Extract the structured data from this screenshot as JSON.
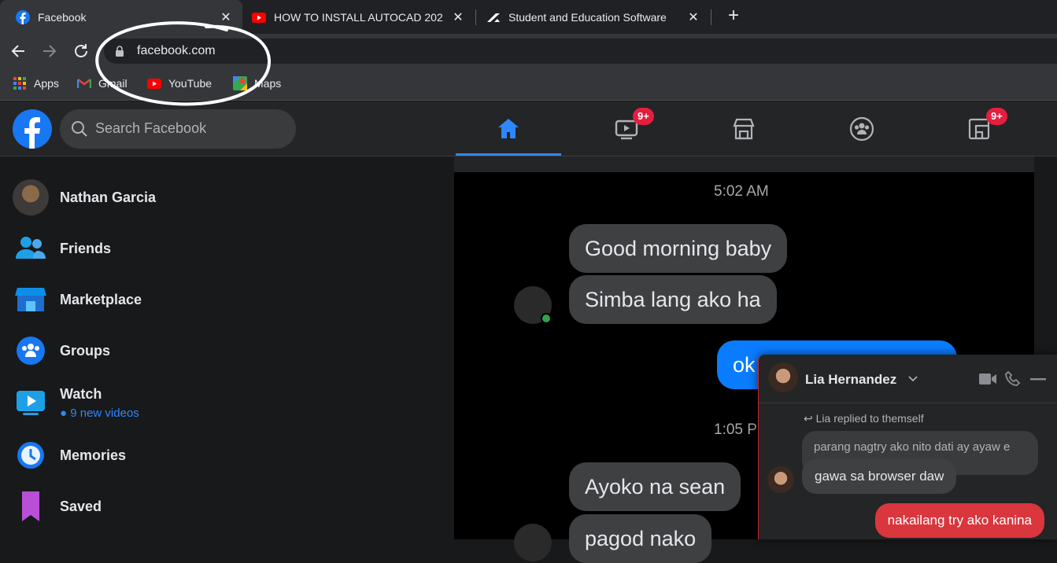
{
  "browser": {
    "tabs": [
      {
        "title": "Facebook",
        "icon": "facebook-icon",
        "active": true
      },
      {
        "title": "HOW TO INSTALL AUTOCAD 202",
        "icon": "youtube-icon",
        "active": false
      },
      {
        "title": "Student and Education Software",
        "icon": "autodesk-icon",
        "active": false
      }
    ],
    "close_glyph": "✕",
    "new_tab_glyph": "+",
    "url": "facebook.com",
    "bookmarks": [
      {
        "label": "Apps",
        "icon": "apps-grid-icon"
      },
      {
        "label": "Gmail",
        "icon": "gmail-icon"
      },
      {
        "label": "YouTube",
        "icon": "youtube-icon"
      },
      {
        "label": "Maps",
        "icon": "maps-icon"
      }
    ]
  },
  "facebook": {
    "search_placeholder": "Search Facebook",
    "nav": [
      {
        "name": "home",
        "badge": ""
      },
      {
        "name": "watch",
        "badge": "9+"
      },
      {
        "name": "marketplace",
        "badge": ""
      },
      {
        "name": "groups",
        "badge": ""
      },
      {
        "name": "gaming",
        "badge": "9+"
      }
    ],
    "sidebar": [
      {
        "label": "Nathan Garcia",
        "icon": "profile-avatar"
      },
      {
        "label": "Friends",
        "icon": "friends-icon"
      },
      {
        "label": "Marketplace",
        "icon": "marketplace-icon"
      },
      {
        "label": "Groups",
        "icon": "groups-icon"
      },
      {
        "label": "Watch",
        "icon": "watch-icon",
        "sub": "9 new videos"
      },
      {
        "label": "Memories",
        "icon": "memories-icon"
      },
      {
        "label": "Saved",
        "icon": "saved-icon"
      }
    ]
  },
  "post_image": {
    "timestamps": [
      "5:02 AM",
      "1:05 P"
    ],
    "messages": [
      {
        "text": "Good morning baby",
        "from": "them"
      },
      {
        "text": "Simba lang ako ha",
        "from": "them"
      },
      {
        "text": "ok",
        "from": "me"
      },
      {
        "text": "Ayoko na sean",
        "from": "them"
      },
      {
        "text": "pagod nako",
        "from": "them"
      }
    ]
  },
  "chat": {
    "name": "Lia Hernandez",
    "reply_note": "Lia replied to themself",
    "quoted": "parang nagtry ako nito dati ay ayaw e",
    "messages": [
      {
        "text": "gawa sa browser daw",
        "from": "them"
      },
      {
        "text": "nakailang try ako kanina",
        "from": "me"
      }
    ]
  },
  "colors": {
    "fb_blue": "#1877f2",
    "badge_red": "#e41e3f",
    "my_bubble": "#d9363e"
  }
}
